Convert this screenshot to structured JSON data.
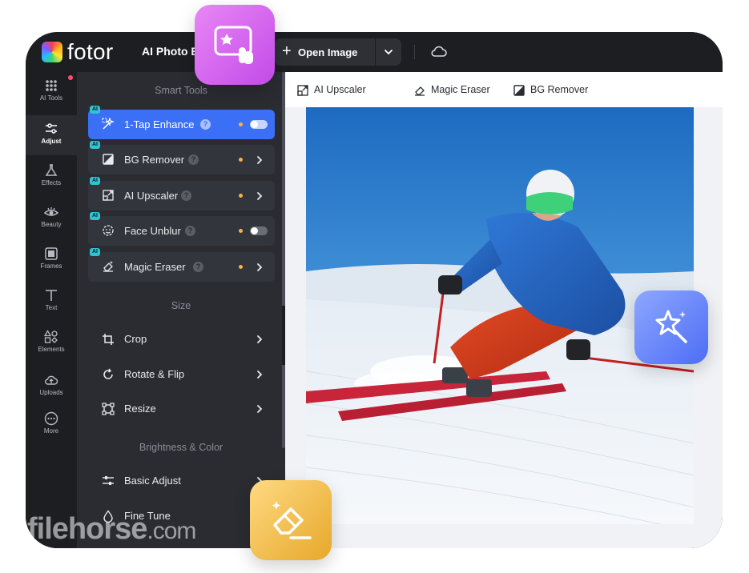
{
  "header": {
    "brand": "fotor",
    "app_title": "AI Photo Ed",
    "open_image_label": "Open Image"
  },
  "rail": {
    "items": [
      {
        "label": "AI Tools",
        "icon": "dots-grid-icon"
      },
      {
        "label": "Adjust",
        "icon": "sliders-icon",
        "active": true
      },
      {
        "label": "Effects",
        "icon": "flask-icon"
      },
      {
        "label": "Beauty",
        "icon": "eye-icon"
      },
      {
        "label": "Frames",
        "icon": "frame-icon"
      },
      {
        "label": "Text",
        "icon": "text-icon"
      },
      {
        "label": "Elements",
        "icon": "shapes-icon"
      },
      {
        "label": "Uploads",
        "icon": "upload-icon"
      },
      {
        "label": "More",
        "icon": "more-icon"
      }
    ]
  },
  "panel": {
    "smart_tools_title": "Smart Tools",
    "smart_tools": [
      {
        "label": "1-Tap Enhance",
        "badge": "AI",
        "control": "toggle",
        "active": true
      },
      {
        "label": "BG Remover",
        "badge": "AI",
        "control": "chevron"
      },
      {
        "label": "AI Upscaler",
        "badge": "AI",
        "control": "chevron"
      },
      {
        "label": "Face Unblur",
        "badge": "AI",
        "control": "toggle"
      },
      {
        "label": "Magic Eraser",
        "badge": "AI",
        "control": "chevron"
      }
    ],
    "size_title": "Size",
    "size_tools": [
      {
        "label": "Crop"
      },
      {
        "label": "Rotate & Flip"
      },
      {
        "label": "Resize"
      }
    ],
    "brightness_title": "Brightness & Color",
    "brightness_tools": [
      {
        "label": "Basic Adjust"
      },
      {
        "label": "Fine Tune"
      }
    ],
    "help_glyph": "?"
  },
  "subbar": {
    "items": [
      {
        "label": "AI Upscaler",
        "icon": "upscale-icon"
      },
      {
        "label": "Magic Eraser",
        "icon": "eraser-icon"
      },
      {
        "label": "BG Remover",
        "icon": "bg-remove-icon"
      }
    ]
  },
  "watermark": {
    "main": "filehorse",
    "suffix": ".com"
  },
  "colors": {
    "accent": "#3b6ff5",
    "ai_badge": "#2ec5d3",
    "dot": "#ffae45"
  }
}
